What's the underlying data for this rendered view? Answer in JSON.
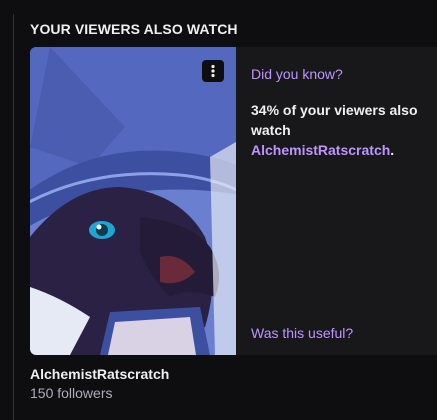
{
  "section": {
    "title": "YOUR VIEWERS ALSO WATCH"
  },
  "card": {
    "more_icon": "vertical-ellipsis-icon",
    "did_you_know": "Did you know?",
    "fact_prefix": "34% of your viewers also watch ",
    "fact_channel": "AlchemistRatscratch",
    "fact_suffix": ".",
    "useful_prompt": "Was this useful?"
  },
  "channel": {
    "name": "AlchemistRatscratch",
    "followers": "150 followers"
  },
  "colors": {
    "background": "#0e0e10",
    "card": "#18181b",
    "accent": "#bf94ff",
    "text": "#efeff1",
    "muted": "#adadb8"
  }
}
